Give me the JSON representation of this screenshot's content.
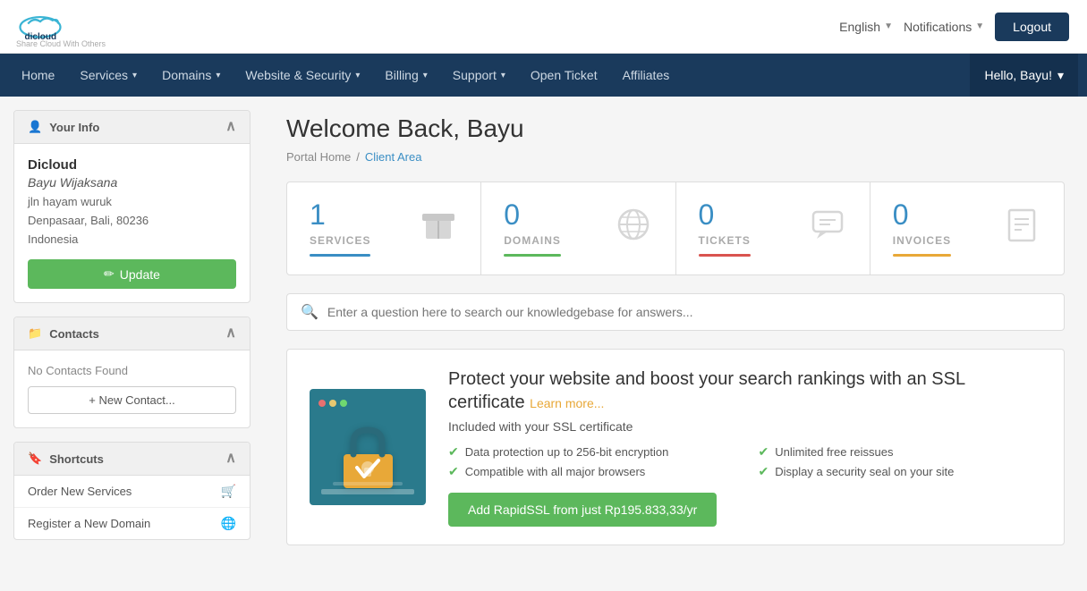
{
  "topbar": {
    "logo_text": "dicloud",
    "logo_subtext": "Share Cloud With Others",
    "language": "English",
    "notifications": "Notifications",
    "logout": "Logout"
  },
  "nav": {
    "items": [
      {
        "label": "Home",
        "has_dropdown": false
      },
      {
        "label": "Services",
        "has_dropdown": true
      },
      {
        "label": "Domains",
        "has_dropdown": true
      },
      {
        "label": "Website & Security",
        "has_dropdown": true
      },
      {
        "label": "Billing",
        "has_dropdown": true
      },
      {
        "label": "Support",
        "has_dropdown": true
      },
      {
        "label": "Open Ticket",
        "has_dropdown": false
      },
      {
        "label": "Affiliates",
        "has_dropdown": false
      }
    ],
    "user_greeting": "Hello, Bayu!"
  },
  "sidebar": {
    "your_info": {
      "header": "Your Info",
      "company": "Dicloud",
      "person": "Bayu Wijaksana",
      "address1": "jln hayam wuruk",
      "address2": "Denpasaar, Bali, 80236",
      "address3": "Indonesia",
      "update_btn": "Update"
    },
    "contacts": {
      "header": "Contacts",
      "empty_msg": "No Contacts Found",
      "new_contact_btn": "+ New Contact..."
    },
    "shortcuts": {
      "header": "Shortcuts",
      "items": [
        {
          "label": "Order New Services",
          "icon": "cart"
        },
        {
          "label": "Register a New Domain",
          "icon": "globe"
        }
      ]
    }
  },
  "main": {
    "welcome_title": "Welcome Back, Bayu",
    "breadcrumb": {
      "home": "Portal Home",
      "separator": "/",
      "current": "Client Area"
    },
    "stats": [
      {
        "number": "1",
        "label": "SERVICES",
        "color_class": "ul-blue"
      },
      {
        "number": "0",
        "label": "DOMAINS",
        "color_class": "ul-green"
      },
      {
        "number": "0",
        "label": "TICKETS",
        "color_class": "ul-red"
      },
      {
        "number": "0",
        "label": "INVOICES",
        "color_class": "ul-orange"
      }
    ],
    "search": {
      "placeholder": "Enter a question here to search our knowledgebase for answers..."
    },
    "ssl_promo": {
      "title": "Protect your website and boost your search rankings with an SSL certificate",
      "learn_more": "Learn more...",
      "included": "Included with your SSL certificate",
      "features": [
        "Data protection up to 256-bit encryption",
        "Compatible with all major browsers",
        "Unlimited free reissues",
        "Display a security seal on your site"
      ],
      "cta_button": "Add RapidSSL from just Rp195.833,33/yr"
    }
  }
}
